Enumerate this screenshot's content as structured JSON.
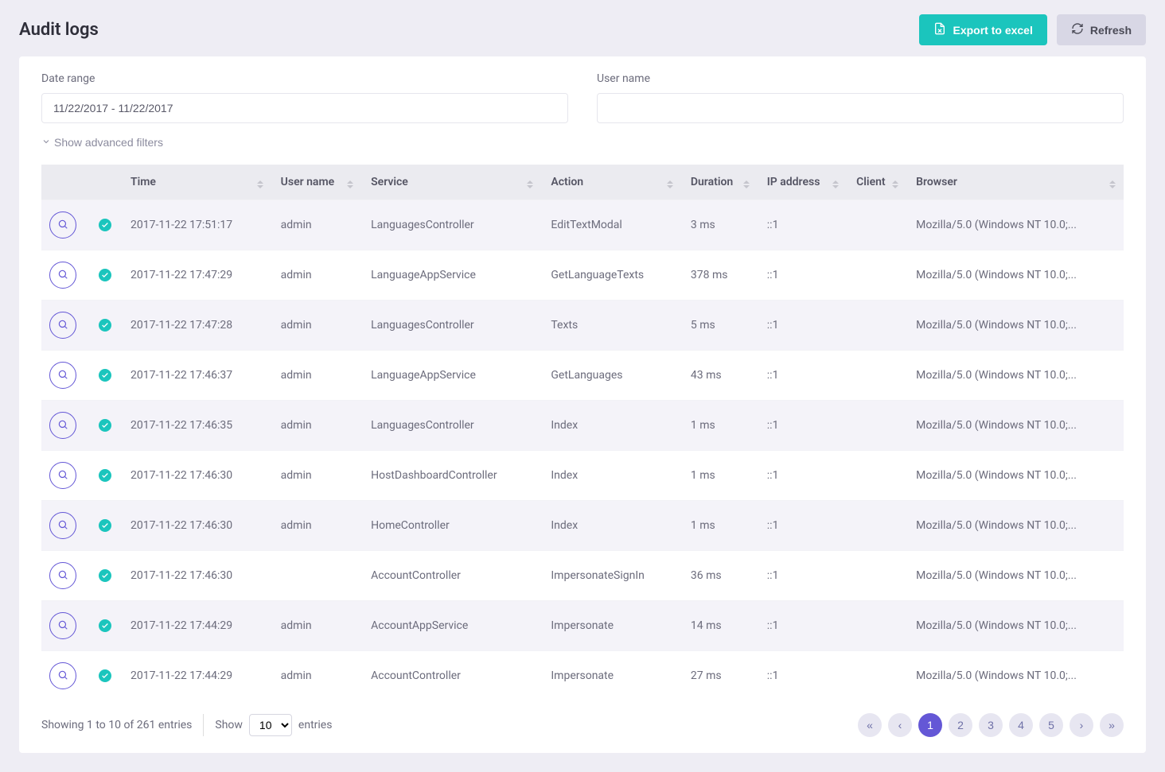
{
  "header": {
    "title": "Audit logs",
    "export_label": "Export to excel",
    "refresh_label": "Refresh"
  },
  "filters": {
    "date_range_label": "Date range",
    "date_range_value": "11/22/2017 - 11/22/2017",
    "username_label": "User name",
    "username_value": "",
    "advanced_filters_label": "Show advanced filters"
  },
  "table": {
    "columns": {
      "time": "Time",
      "username": "User name",
      "service": "Service",
      "action": "Action",
      "duration": "Duration",
      "ip": "IP address",
      "client": "Client",
      "browser": "Browser"
    },
    "rows": [
      {
        "time": "2017-11-22 17:51:17",
        "user": "admin",
        "service": "LanguagesController",
        "action": "EditTextModal",
        "duration": "3 ms",
        "ip": "::1",
        "client": "",
        "browser": "Mozilla/5.0 (Windows NT 10.0;..."
      },
      {
        "time": "2017-11-22 17:47:29",
        "user": "admin",
        "service": "LanguageAppService",
        "action": "GetLanguageTexts",
        "duration": "378 ms",
        "ip": "::1",
        "client": "",
        "browser": "Mozilla/5.0 (Windows NT 10.0;..."
      },
      {
        "time": "2017-11-22 17:47:28",
        "user": "admin",
        "service": "LanguagesController",
        "action": "Texts",
        "duration": "5 ms",
        "ip": "::1",
        "client": "",
        "browser": "Mozilla/5.0 (Windows NT 10.0;..."
      },
      {
        "time": "2017-11-22 17:46:37",
        "user": "admin",
        "service": "LanguageAppService",
        "action": "GetLanguages",
        "duration": "43 ms",
        "ip": "::1",
        "client": "",
        "browser": "Mozilla/5.0 (Windows NT 10.0;..."
      },
      {
        "time": "2017-11-22 17:46:35",
        "user": "admin",
        "service": "LanguagesController",
        "action": "Index",
        "duration": "1 ms",
        "ip": "::1",
        "client": "",
        "browser": "Mozilla/5.0 (Windows NT 10.0;..."
      },
      {
        "time": "2017-11-22 17:46:30",
        "user": "admin",
        "service": "HostDashboardController",
        "action": "Index",
        "duration": "1 ms",
        "ip": "::1",
        "client": "",
        "browser": "Mozilla/5.0 (Windows NT 10.0;..."
      },
      {
        "time": "2017-11-22 17:46:30",
        "user": "admin",
        "service": "HomeController",
        "action": "Index",
        "duration": "1 ms",
        "ip": "::1",
        "client": "",
        "browser": "Mozilla/5.0 (Windows NT 10.0;..."
      },
      {
        "time": "2017-11-22 17:46:30",
        "user": "",
        "service": "AccountController",
        "action": "ImpersonateSignIn",
        "duration": "36 ms",
        "ip": "::1",
        "client": "",
        "browser": "Mozilla/5.0 (Windows NT 10.0;..."
      },
      {
        "time": "2017-11-22 17:44:29",
        "user": "admin",
        "service": "AccountAppService",
        "action": "Impersonate",
        "duration": "14 ms",
        "ip": "::1",
        "client": "",
        "browser": "Mozilla/5.0 (Windows NT 10.0;..."
      },
      {
        "time": "2017-11-22 17:44:29",
        "user": "admin",
        "service": "AccountController",
        "action": "Impersonate",
        "duration": "27 ms",
        "ip": "::1",
        "client": "",
        "browser": "Mozilla/5.0 (Windows NT 10.0;..."
      }
    ]
  },
  "footer": {
    "info": "Showing 1 to 10 of 261 entries",
    "show_label": "Show",
    "entries_label": "entries",
    "page_size": "10",
    "pages": [
      "1",
      "2",
      "3",
      "4",
      "5"
    ],
    "active_page": "1"
  }
}
